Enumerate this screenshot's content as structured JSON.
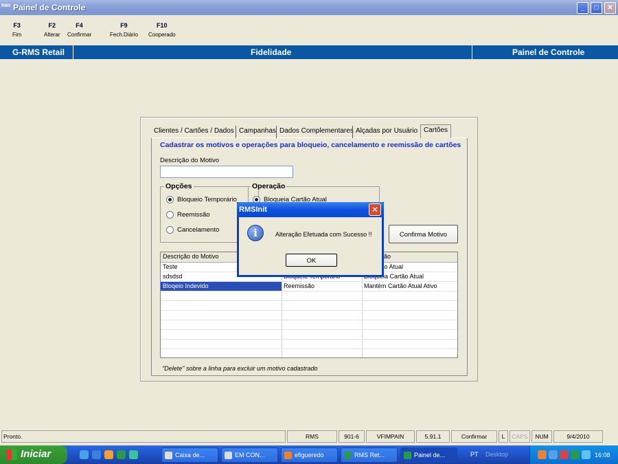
{
  "window": {
    "logo_text": "RMS",
    "title": "Painel de Controle",
    "buttons": [
      "_",
      "□",
      "✕"
    ]
  },
  "fkeys": [
    {
      "key": "F3",
      "label": "Fim"
    },
    {
      "key": "F2",
      "label": "Alterar"
    },
    {
      "key": "F4",
      "label": "Confirmar"
    },
    {
      "key": "F9",
      "label": "Fech.Diário"
    },
    {
      "key": "F10",
      "label": "Cooperado"
    }
  ],
  "header": {
    "left": "G-RMS Retail",
    "center": "Fidelidade",
    "right": "Painel de Controle"
  },
  "tabs": [
    "Clientes / Cartões / Dados",
    "Campanhas",
    "Dados Complementares",
    "Alçadas por Usuário",
    "Cartões"
  ],
  "form": {
    "heading": "Cadastrar os motivos e operações para bloqueio, cancelamento e reemissão de cartões",
    "motivo_label": "Descrição do Motivo",
    "motivo_value": "",
    "opcoes_title": "Opções",
    "opcoes": [
      "Bloqueio Temporário",
      "Reemissão",
      "Cancelamento"
    ],
    "operacao_title": "Operação",
    "operacao_first": "Bloqueia Cartão Atual",
    "confirm_button": "Confirma Motivo"
  },
  "grid": {
    "headers": [
      "Descrição do Motivo",
      "",
      "ão"
    ],
    "rows": [
      [
        "Teste",
        "",
        "a Cartão Atual"
      ],
      [
        "sdsdsd",
        "Bloqueio Temporário",
        "Bloqueia Cartão Atual"
      ],
      [
        "Bloqeio Indevido",
        "Reemissão",
        "Mantém Cartão Atual Ativo"
      ]
    ],
    "hint": "\"Delete\" sobre a linha para excluir um motivo cadastrado"
  },
  "dialog": {
    "title": "RMSInit",
    "message": "Alteração Efetuada com Sucesso !!",
    "ok": "OK"
  },
  "status": [
    "Pronto.",
    "RMS",
    "901-6",
    "VFIMPAIN",
    "5.91.1",
    "Confirmar",
    "L",
    "CAPS",
    "NUM",
    "9/4/2010"
  ],
  "taskbar": {
    "start": "Iniciar",
    "tasks": [
      "Caixa de...",
      "EM CON...",
      "efigueredo",
      "RMS Ret...",
      "Painel de..."
    ],
    "pt": "PT",
    "desktop": "Desktop",
    "clock": "16:08"
  }
}
